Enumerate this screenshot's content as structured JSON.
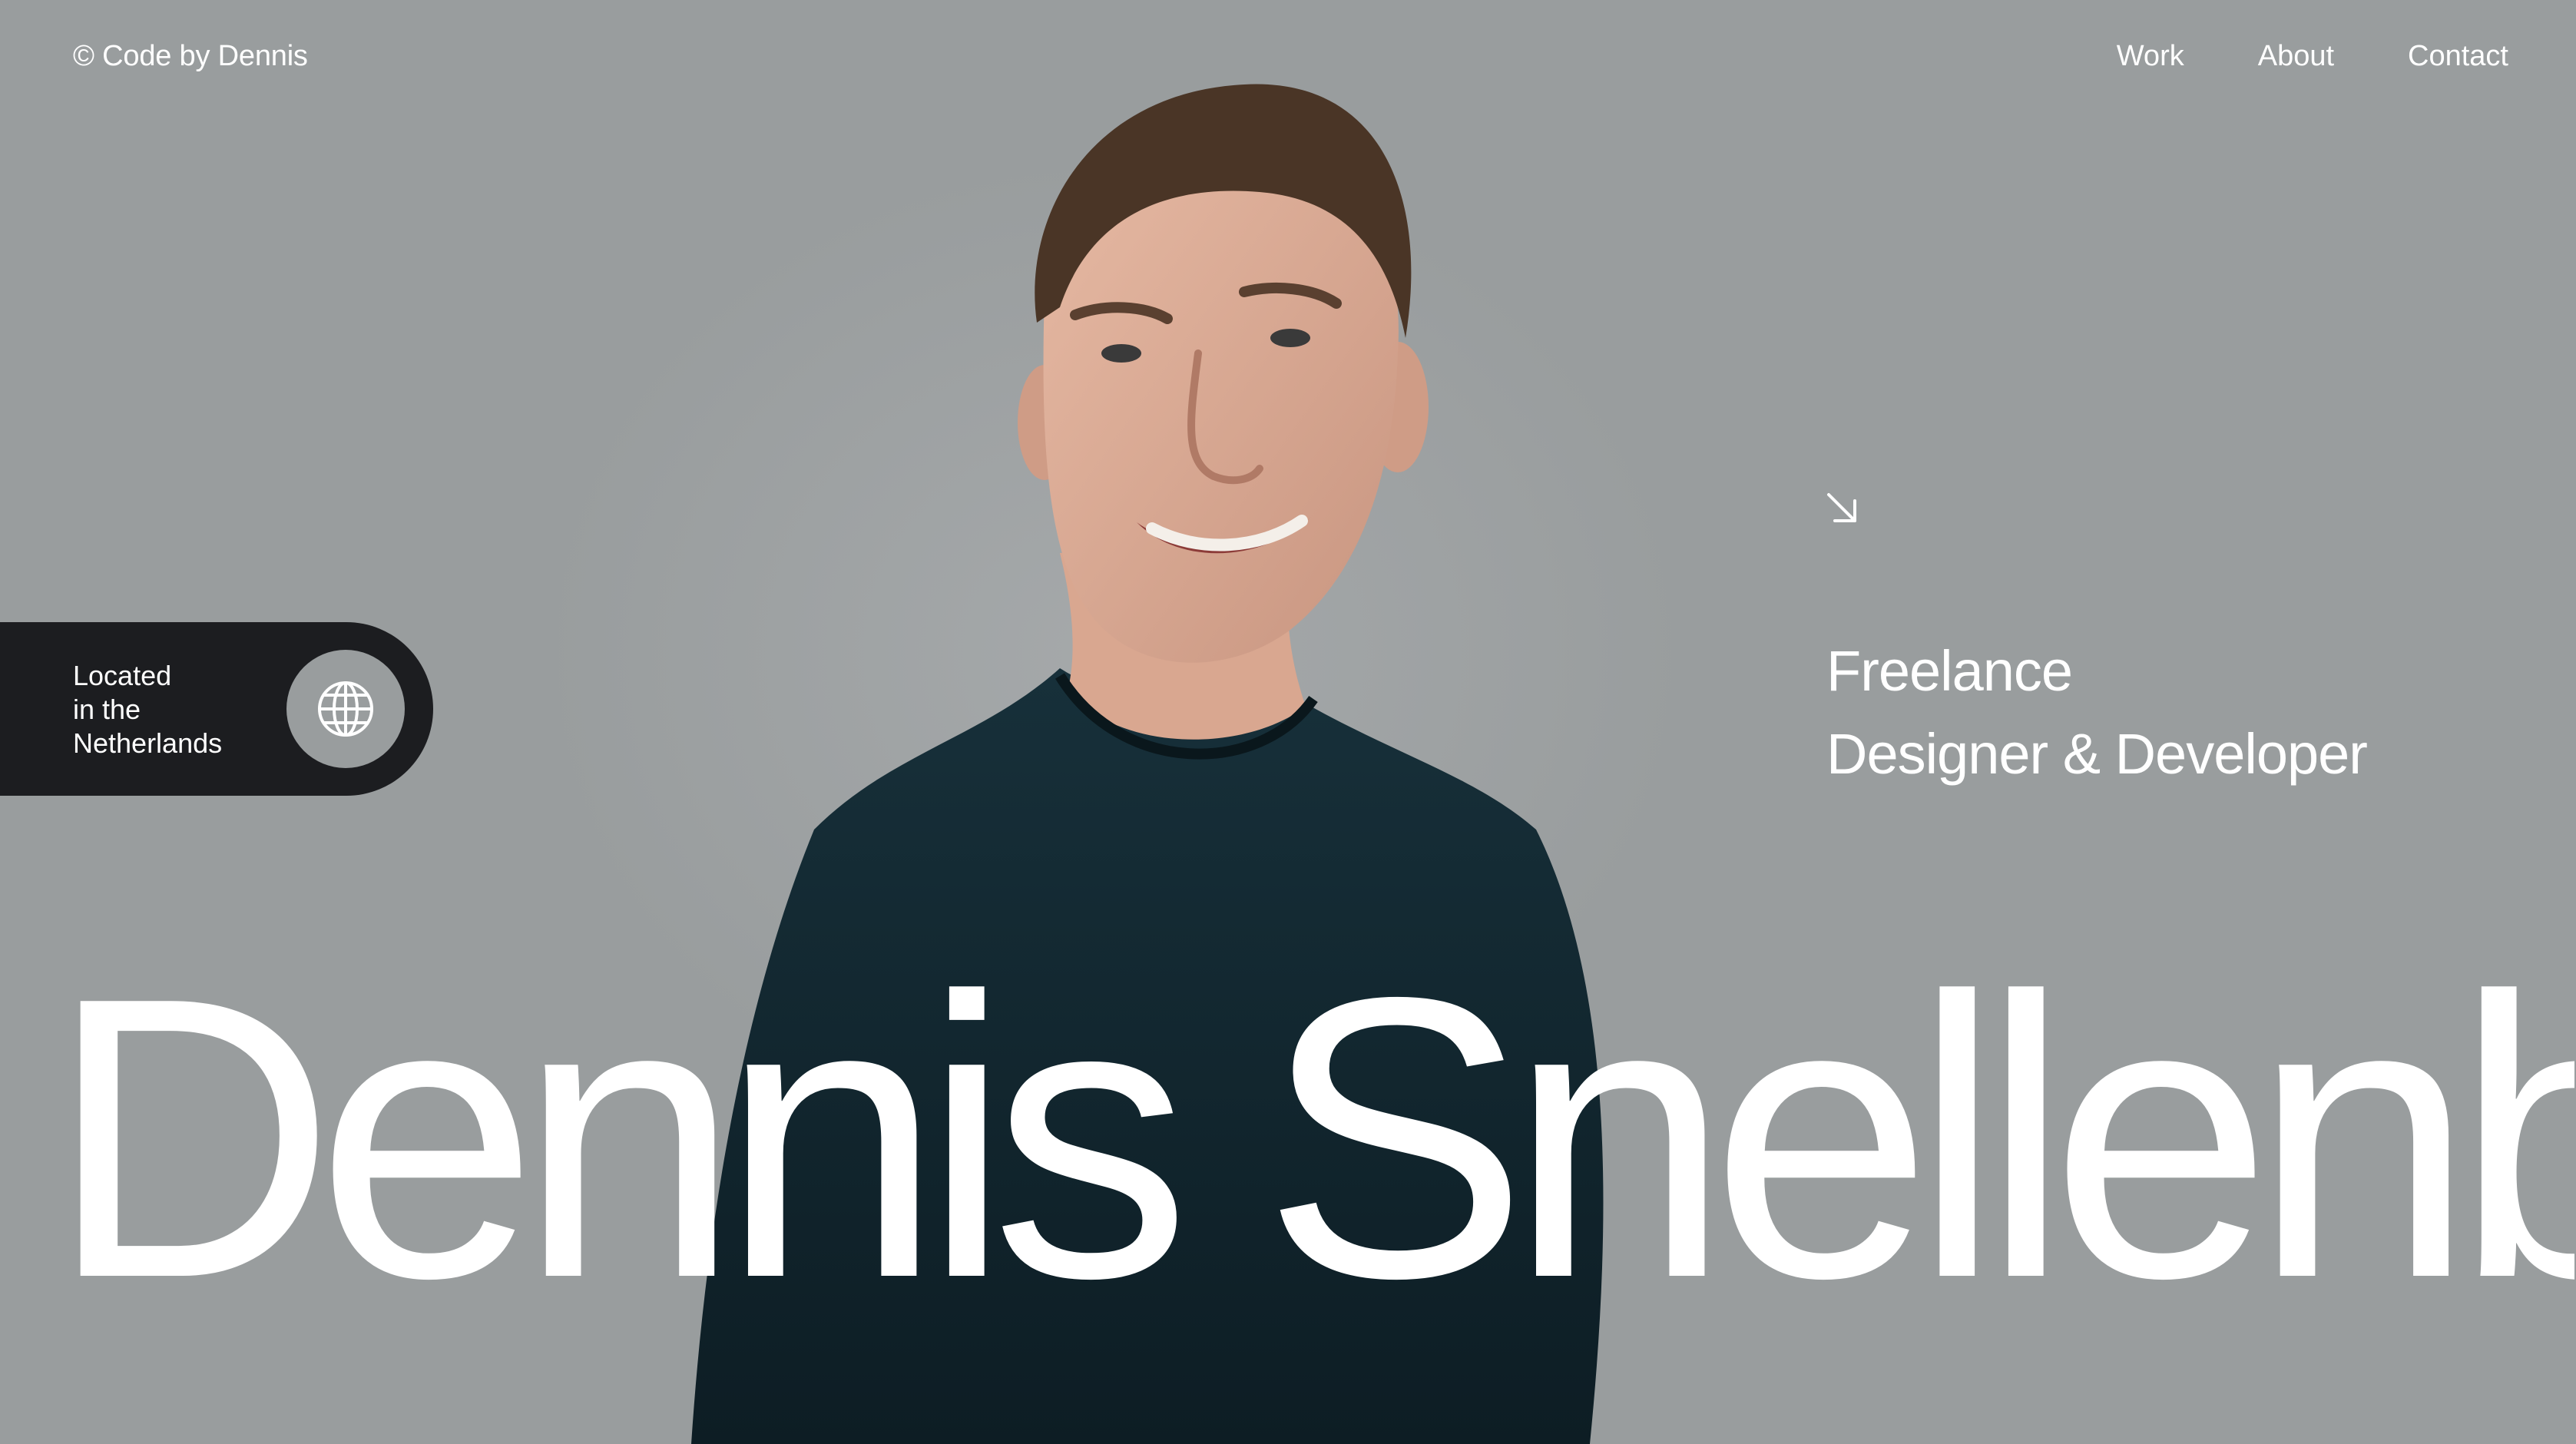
{
  "header": {
    "brand": "© Code by Dennis",
    "nav": [
      {
        "label": "Work"
      },
      {
        "label": "About"
      },
      {
        "label": "Contact"
      }
    ]
  },
  "location": {
    "text": "Located\nin the\nNetherlands",
    "icon": "globe-icon"
  },
  "hero": {
    "arrow_icon": "arrow-down-right-icon",
    "role_line1": "Freelance",
    "role_line2": "Designer & Developer",
    "name": "Dennis Snellenb"
  },
  "colors": {
    "background": "#999d9e",
    "pill": "#1c1d20",
    "text": "#ffffff",
    "sweater": "#142730"
  }
}
